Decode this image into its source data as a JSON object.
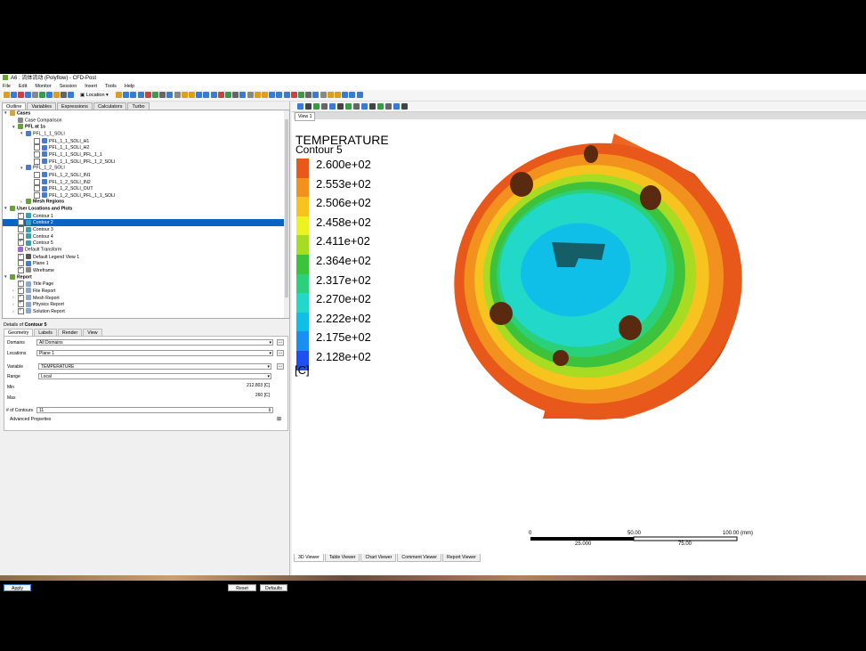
{
  "window": {
    "title": "A6 : 流体流动 (Polyflow) - CFD-Post"
  },
  "menu": [
    "File",
    "Edit",
    "Monitor",
    "Session",
    "Insert",
    "Tools",
    "Help"
  ],
  "toolbar": {
    "location_label": "Location"
  },
  "left_tabs": [
    "Outline",
    "Variables",
    "Expressions",
    "Calculators",
    "Turbo"
  ],
  "tree": [
    {
      "label": "Cases",
      "depth": 0,
      "bold": true,
      "expander": "▾",
      "checkbox": null,
      "icon": "#d9a33a"
    },
    {
      "label": "Case Comparison",
      "depth": 1,
      "bold": false,
      "expander": "",
      "checkbox": null,
      "icon": "#888"
    },
    {
      "label": "PFL at 1s",
      "depth": 1,
      "bold": true,
      "expander": "▾",
      "checkbox": null,
      "icon": "#6a9e3a"
    },
    {
      "label": "PFL_1_1_SOLI",
      "depth": 2,
      "bold": false,
      "expander": "▾",
      "checkbox": null,
      "icon": "#4a7ad0"
    },
    {
      "label": "PFL_1_1_SOLI_H1",
      "depth": 3,
      "bold": false,
      "expander": "",
      "checkbox": false,
      "icon": "#4a7ad0"
    },
    {
      "label": "PFL_1_1_SOLI_H2",
      "depth": 3,
      "bold": false,
      "expander": "",
      "checkbox": false,
      "icon": "#4a7ad0"
    },
    {
      "label": "PFL_1_1_SOLI_PFL_1_1",
      "depth": 3,
      "bold": false,
      "expander": "",
      "checkbox": false,
      "icon": "#4a7ad0"
    },
    {
      "label": "PFL_1_1_SOLI_PFL_1_2_SOLI",
      "depth": 3,
      "bold": false,
      "expander": "",
      "checkbox": false,
      "icon": "#4a7ad0"
    },
    {
      "label": "PFL_1_2_SOLI",
      "depth": 2,
      "bold": false,
      "expander": "▾",
      "checkbox": null,
      "icon": "#4a7ad0"
    },
    {
      "label": "PFL_1_2_SOLI_IN1",
      "depth": 3,
      "bold": false,
      "expander": "",
      "checkbox": false,
      "icon": "#4a7ad0"
    },
    {
      "label": "PFL_1_2_SOLI_IN2",
      "depth": 3,
      "bold": false,
      "expander": "",
      "checkbox": false,
      "icon": "#4a7ad0"
    },
    {
      "label": "PFL_1_2_SOLI_OUT",
      "depth": 3,
      "bold": false,
      "expander": "",
      "checkbox": false,
      "icon": "#4a7ad0"
    },
    {
      "label": "PFL_1_2_SOLI_PFL_1_1_SOLI",
      "depth": 3,
      "bold": false,
      "expander": "",
      "checkbox": false,
      "icon": "#4a7ad0"
    },
    {
      "label": "Mesh Regions",
      "depth": 2,
      "bold": true,
      "expander": "›",
      "checkbox": null,
      "icon": "#6a9e3a"
    },
    {
      "label": "User Locations and Plots",
      "depth": 0,
      "bold": true,
      "expander": "▾",
      "checkbox": null,
      "icon": "#6a9e3a"
    },
    {
      "label": "Contour 1",
      "depth": 1,
      "bold": false,
      "expander": "",
      "checkbox": true,
      "icon": "#3aa0b0"
    },
    {
      "label": "Contour 2",
      "depth": 1,
      "bold": false,
      "expander": "",
      "checkbox": false,
      "icon": "#3aa0b0",
      "selected": true
    },
    {
      "label": "Contour 3",
      "depth": 1,
      "bold": false,
      "expander": "",
      "checkbox": false,
      "icon": "#3aa0b0"
    },
    {
      "label": "Contour 4",
      "depth": 1,
      "bold": false,
      "expander": "",
      "checkbox": false,
      "icon": "#3aa0b0"
    },
    {
      "label": "Contour 5",
      "depth": 1,
      "bold": false,
      "expander": "",
      "checkbox": true,
      "icon": "#3aa0b0"
    },
    {
      "label": "Default Transform",
      "depth": 1,
      "bold": false,
      "expander": "",
      "checkbox": null,
      "icon": "#9a6ad0"
    },
    {
      "label": "Default Legend View 1",
      "depth": 1,
      "bold": false,
      "expander": "",
      "checkbox": true,
      "icon": "#555"
    },
    {
      "label": "Plane 1",
      "depth": 1,
      "bold": false,
      "expander": "",
      "checkbox": false,
      "icon": "#4a7ad0"
    },
    {
      "label": "Wireframe",
      "depth": 1,
      "bold": false,
      "expander": "",
      "checkbox": true,
      "icon": "#888"
    },
    {
      "label": "Report",
      "depth": 0,
      "bold": true,
      "expander": "▾",
      "checkbox": null,
      "icon": "#6a9e3a"
    },
    {
      "label": "Title Page",
      "depth": 1,
      "bold": false,
      "expander": "",
      "checkbox": true,
      "icon": "#8aa8d0"
    },
    {
      "label": "File Report",
      "depth": 1,
      "bold": false,
      "expander": "›",
      "checkbox": true,
      "icon": "#8aa8d0"
    },
    {
      "label": "Mesh Report",
      "depth": 1,
      "bold": false,
      "expander": "›",
      "checkbox": true,
      "icon": "#8aa8d0"
    },
    {
      "label": "Physics Report",
      "depth": 1,
      "bold": false,
      "expander": "›",
      "checkbox": true,
      "icon": "#8aa8d0"
    },
    {
      "label": "Solution Report",
      "depth": 1,
      "bold": false,
      "expander": "›",
      "checkbox": true,
      "icon": "#8aa8d0"
    }
  ],
  "details": {
    "title_prefix": "Details of",
    "title_name": "Contour 5",
    "tabs": [
      "Geometry",
      "Labels",
      "Render",
      "View"
    ],
    "domains_label": "Domains",
    "domains_value": "All Domains",
    "locations_label": "Locations",
    "locations_value": "Plane 1",
    "variable_label": "Variable",
    "variable_value": "TEMPERATURE",
    "range_label": "Range",
    "range_value": "Local",
    "min_label": "Min",
    "min_value": "212.803 [C]",
    "max_label": "Max",
    "max_value": "260 [C]",
    "contours_label": "# of Contours",
    "contours_value": "11",
    "advanced_label": "Advanced Properties",
    "dots": "...",
    "apply": "Apply",
    "reset": "Reset",
    "defaults": "Defaults"
  },
  "viewer": {
    "view_label": "View 1",
    "legend_title": "TEMPERATURE",
    "legend_subtitle": "Contour 5",
    "legend_unit": "[C]",
    "legend_levels": [
      {
        "label": "2.600e+02",
        "color": "#e8581a"
      },
      {
        "label": "2.553e+02",
        "color": "#f3911e"
      },
      {
        "label": "2.506e+02",
        "color": "#f7c31f"
      },
      {
        "label": "2.458e+02",
        "color": "#eef21f"
      },
      {
        "label": "2.411e+02",
        "color": "#a8dc22"
      },
      {
        "label": "2.364e+02",
        "color": "#3cc23c"
      },
      {
        "label": "2.317e+02",
        "color": "#2ad07a"
      },
      {
        "label": "2.270e+02",
        "color": "#22d8c8"
      },
      {
        "label": "2.222e+02",
        "color": "#10bfe8"
      },
      {
        "label": "2.175e+02",
        "color": "#1a8ff2"
      },
      {
        "label": "2.128e+02",
        "color": "#1f4ff0"
      }
    ],
    "scale": {
      "top_labels": [
        "0",
        "50.00",
        "100.00  (mm)"
      ],
      "bottom_labels": [
        "25.000",
        "75.00"
      ]
    },
    "bottom_tabs": [
      "3D Viewer",
      "Table Viewer",
      "Chart Viewer",
      "Comment Viewer",
      "Report Viewer"
    ]
  }
}
